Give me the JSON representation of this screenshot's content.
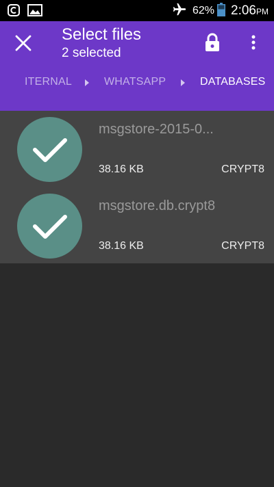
{
  "status_bar": {
    "battery": "62%",
    "time": "2:06",
    "ampm": "PM",
    "icons": [
      "notification-icon",
      "image-icon",
      "airplane-icon",
      "battery-icon"
    ]
  },
  "header": {
    "title": "Select files",
    "subtitle": "2 selected",
    "background_color": "#6d38c8",
    "icons": [
      "close-icon",
      "lock-icon",
      "more-vert-icon"
    ]
  },
  "breadcrumb": {
    "items": [
      "ITERNAL",
      "WHATSAPP",
      "DATABASES"
    ],
    "active_index": 2
  },
  "files": [
    {
      "name": "msgstore-2015-0...",
      "size": "38.16 KB",
      "type": "CRYPT8",
      "selected": true
    },
    {
      "name": "msgstore.db.crypt8",
      "size": "38.16 KB",
      "type": "CRYPT8",
      "selected": true
    }
  ],
  "colors": {
    "accent": "#6d38c8",
    "check_circle": "#5a8f87",
    "list_background": "#444444",
    "page_background": "#2a2a2a"
  }
}
